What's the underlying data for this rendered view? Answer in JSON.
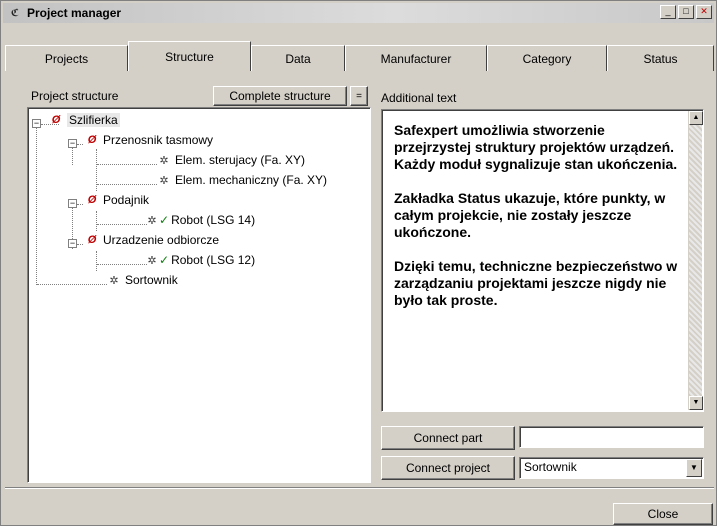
{
  "window": {
    "title": "Project manager",
    "app_icon": "safexpert-logo-icon",
    "controls": [
      "minimize-icon",
      "maximize-icon",
      "close-icon"
    ]
  },
  "tabs": [
    {
      "label": "Projects",
      "active": false
    },
    {
      "label": "Structure",
      "active": true
    },
    {
      "label": "Data",
      "active": false
    },
    {
      "label": "Manufacturer",
      "active": false
    },
    {
      "label": "Category",
      "active": false
    },
    {
      "label": "Status",
      "active": false
    }
  ],
  "left": {
    "section_label": "Project structure",
    "complete_button": "Complete structure",
    "collapse_button": "=",
    "tree": [
      {
        "label": "Szlifierka",
        "icon": "folder-icon",
        "expander": "−"
      },
      {
        "label": "Przenosnik tasmowy",
        "icon": "folder-icon",
        "expander": "−"
      },
      {
        "label": "Elem. sterujacy (Fa. XY)",
        "icon": "part-icon"
      },
      {
        "label": "Elem. mechaniczny (Fa. XY)",
        "icon": "part-icon"
      },
      {
        "label": "Podajnik",
        "icon": "folder-icon",
        "expander": "−"
      },
      {
        "label": "Robot (LSG 14)",
        "icon": "part-check-icon"
      },
      {
        "label": "Urzadzenie odbiorcze",
        "icon": "folder-icon",
        "expander": "−"
      },
      {
        "label": "Robot (LSG 12)",
        "icon": "part-check-icon"
      },
      {
        "label": "Sortownik",
        "icon": "part-icon"
      }
    ]
  },
  "right": {
    "section_label": "Additional text",
    "text": "Safexpert umożliwia stworzenie przejrzystej struktury projektów urządzeń. Każdy moduł sygnalizuje stan ukończenia.\n\nZakładka Status ukazuje, które punkty, w całym projekcie, nie zostały jeszcze ukończone.\n\nDzięki temu, techniczne bezpieczeństwo w zarządzaniu projektami jeszcze nigdy nie było tak proste.",
    "connect_part_button": "Connect part",
    "connect_part_value": "",
    "connect_project_button": "Connect project",
    "connect_project_value": "Sortownik"
  },
  "footer": {
    "close_button": "Close"
  }
}
